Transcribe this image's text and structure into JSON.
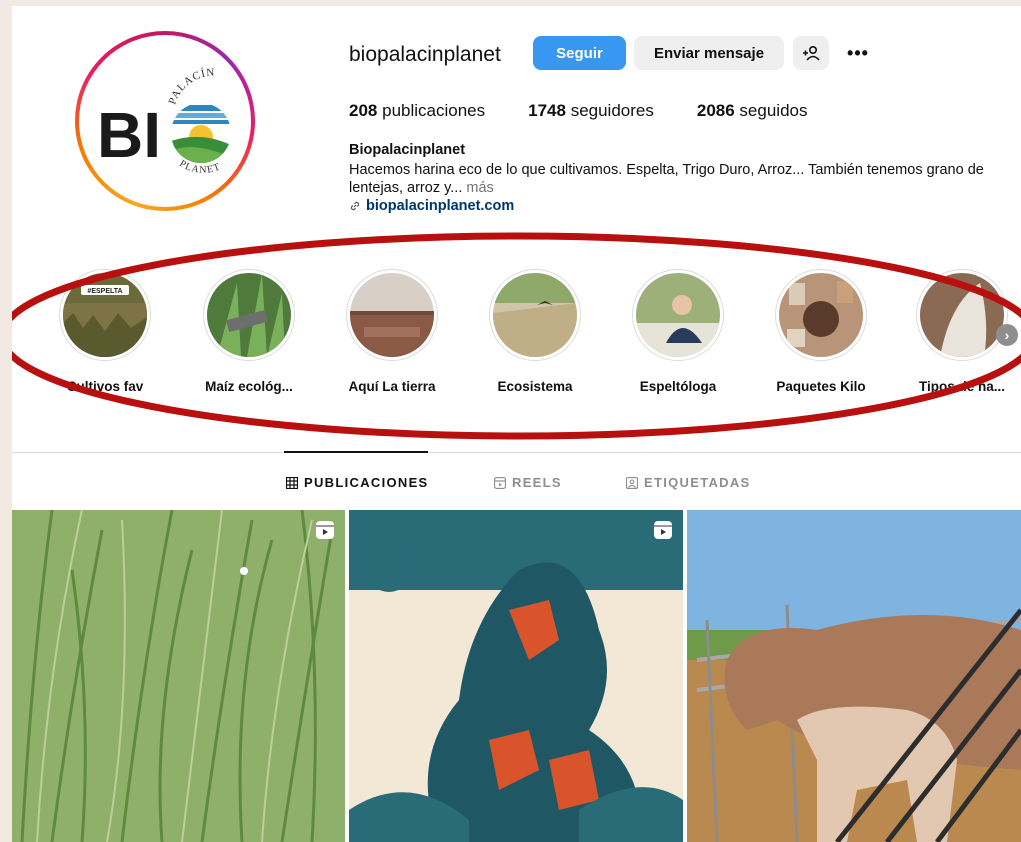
{
  "profile": {
    "username": "biopalacinplanet",
    "follow_label": "Seguir",
    "message_label": "Enviar mensaje",
    "more_label": "•••",
    "logo_text_main": "BI",
    "logo_text_arc_top": "PALACÍN",
    "logo_text_arc_bottom": "PLANET"
  },
  "stats": {
    "posts_count": "208",
    "posts_label": "publicaciones",
    "followers_count": "1748",
    "followers_label": "seguidores",
    "following_count": "2086",
    "following_label": "seguidos"
  },
  "bio": {
    "name": "Biopalacinplanet",
    "text": "Hacemos harina eco de lo que cultivamos. Espelta, Trigo Duro, Arroz... También tenemos grano de lentejas, arroz y...",
    "more": "más",
    "link": "biopalacinplanet.com"
  },
  "highlights": [
    {
      "label": "Cultivos fav",
      "badge": "#ESPELTA"
    },
    {
      "label": "Maíz ecológ..."
    },
    {
      "label": "Aquí La tierra"
    },
    {
      "label": "Ecosistema"
    },
    {
      "label": "Espeltóloga"
    },
    {
      "label": "Paquetes Kilo"
    },
    {
      "label": "Tipos de ha..."
    }
  ],
  "tabs": [
    {
      "label": "PUBLICACIONES",
      "icon": "grid-icon"
    },
    {
      "label": "REELS",
      "icon": "reels-icon"
    },
    {
      "label": "ETIQUETADAS",
      "icon": "tagged-icon"
    }
  ],
  "colors": {
    "accent": "#3897f0",
    "annotation_ellipse": "#b80f0f",
    "link": "#00376b"
  }
}
